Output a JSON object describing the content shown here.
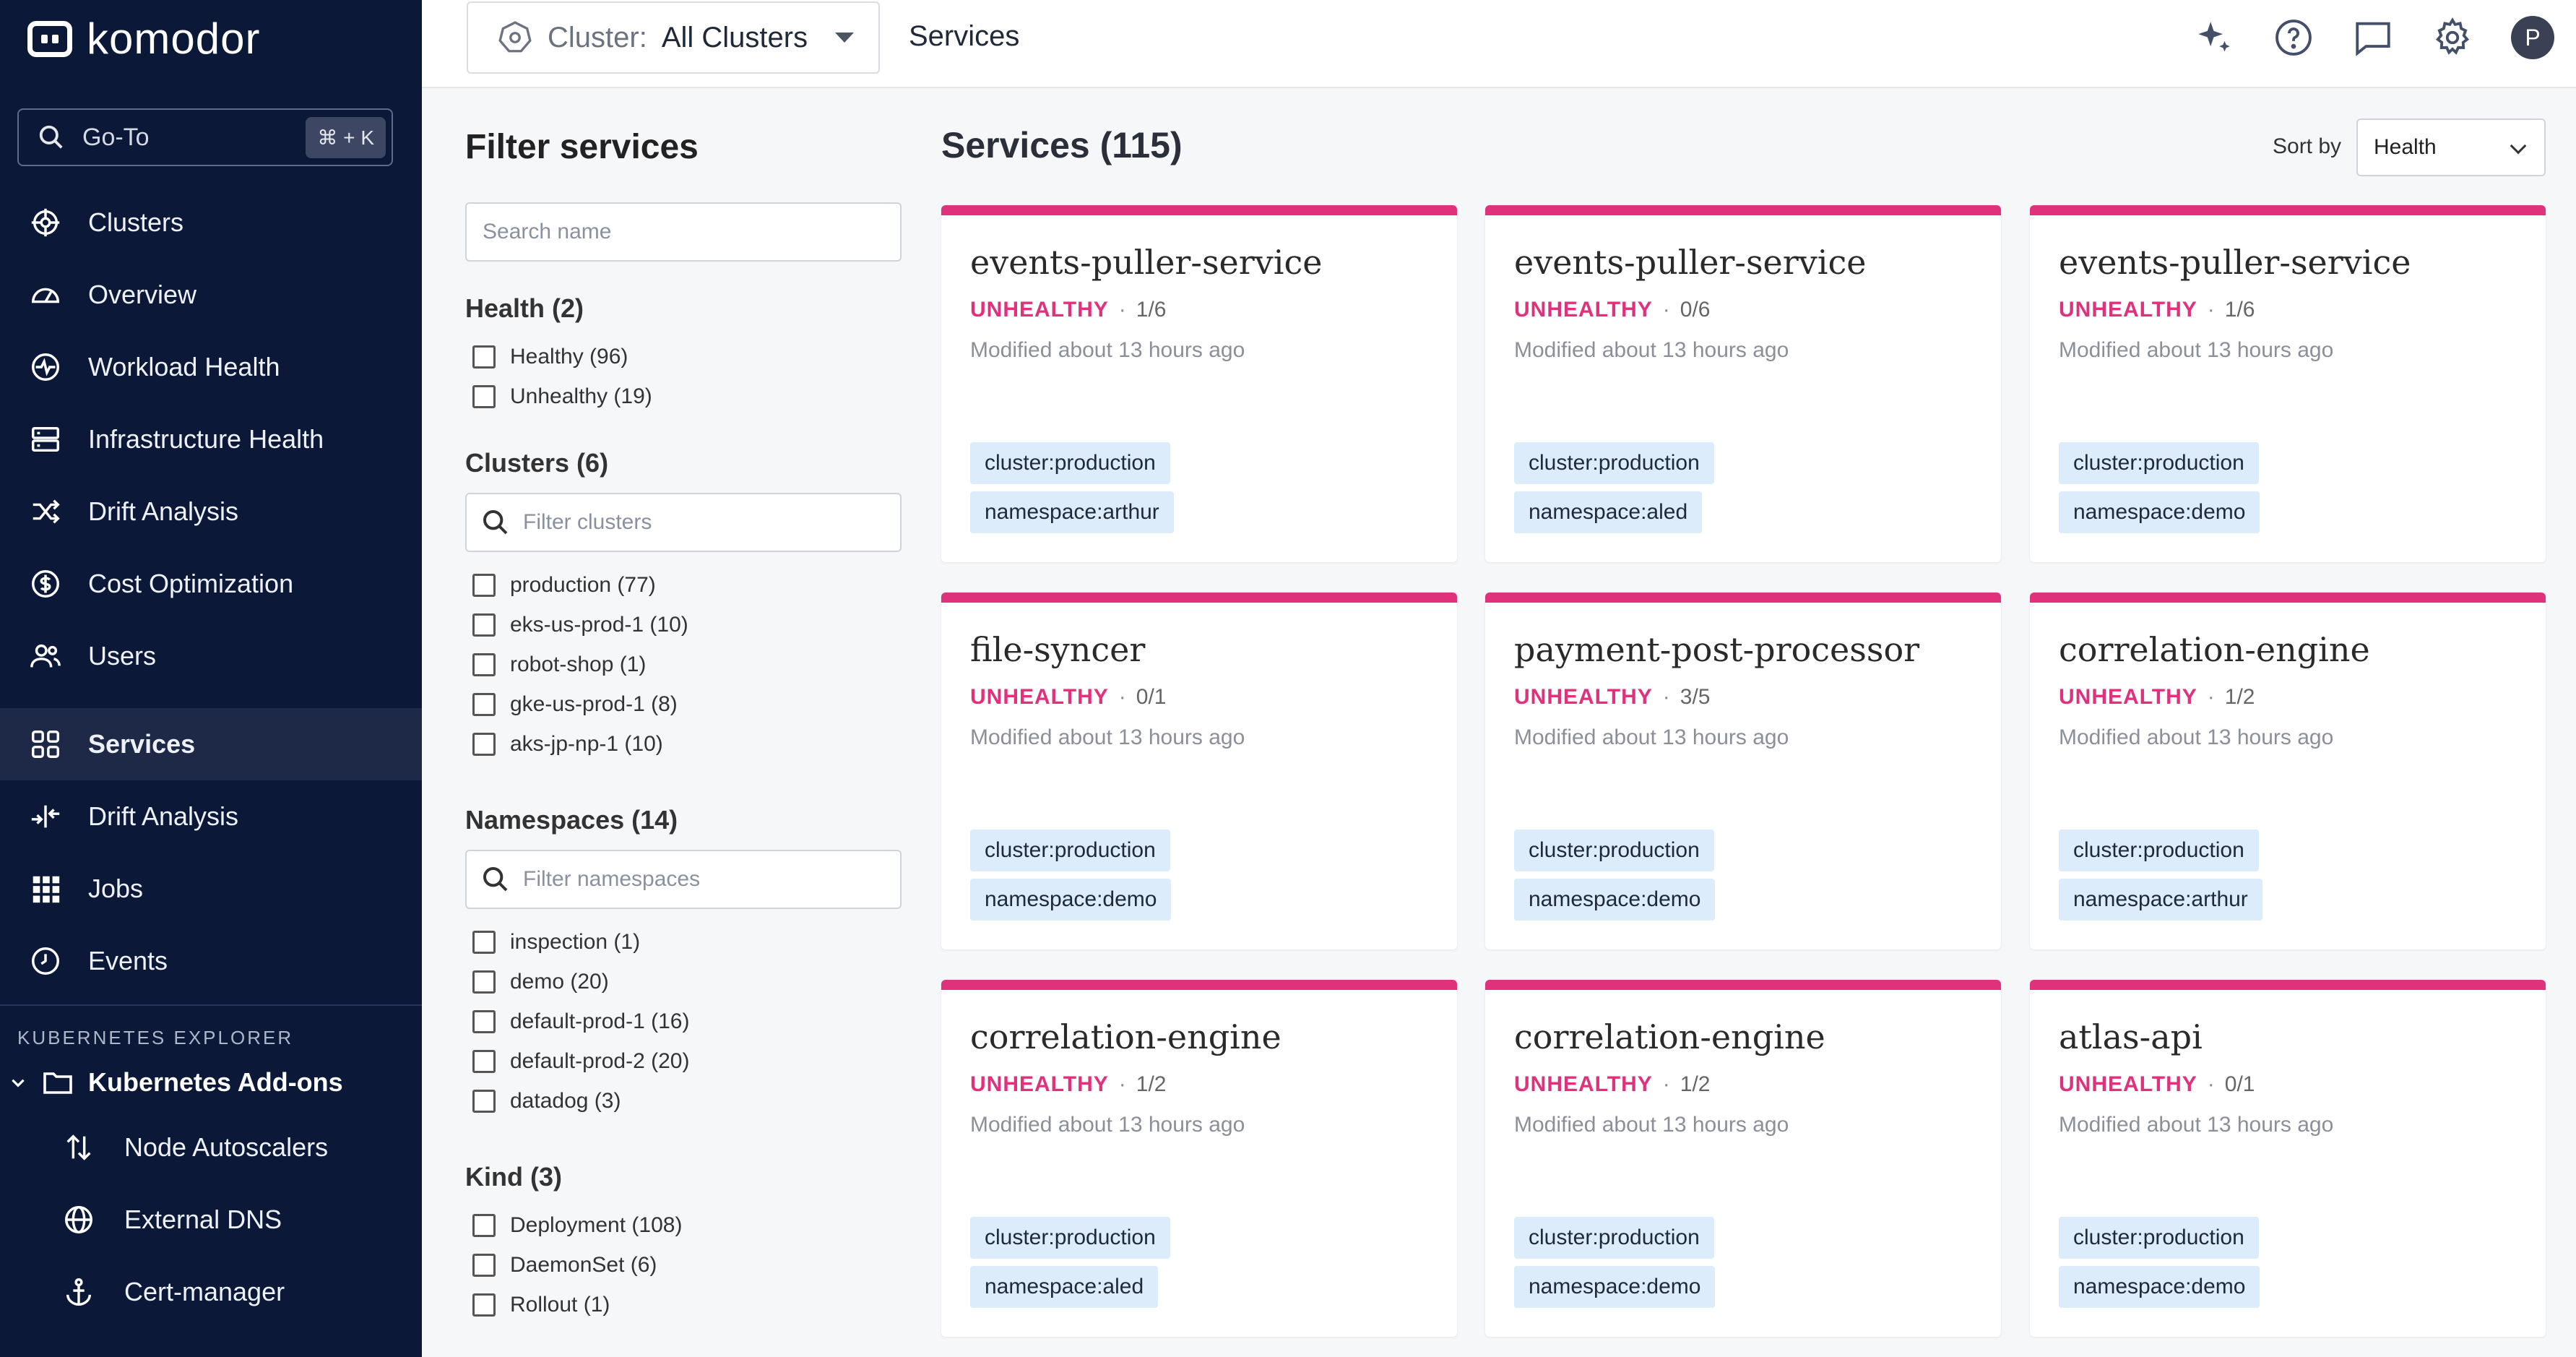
{
  "app": {
    "logo_text": "komodor",
    "goto_label": "Go-To",
    "goto_shortcut": "⌘ + K"
  },
  "sidebar": {
    "items": [
      {
        "label": "Clusters",
        "icon": "helm-wheel-icon"
      },
      {
        "label": "Overview",
        "icon": "gauge-icon"
      },
      {
        "label": "Workload Health",
        "icon": "heartbeat-icon"
      },
      {
        "label": "Infrastructure Health",
        "icon": "server-icon"
      },
      {
        "label": "Drift Analysis",
        "icon": "shuffle-icon"
      },
      {
        "label": "Cost Optimization",
        "icon": "dollar-circle-icon"
      },
      {
        "label": "Users",
        "icon": "users-icon"
      }
    ],
    "items2": [
      {
        "label": "Services",
        "icon": "grid-icon",
        "active": true
      },
      {
        "label": "Drift Analysis",
        "icon": "compare-icon"
      },
      {
        "label": "Jobs",
        "icon": "dots-grid-icon"
      },
      {
        "label": "Events",
        "icon": "clock-icon"
      }
    ],
    "section_label": "KUBERNETES EXPLORER",
    "addons_label": "Kubernetes Add-ons",
    "addons": [
      {
        "label": "Node Autoscalers",
        "icon": "up-down-arrows-icon"
      },
      {
        "label": "External DNS",
        "icon": "globe-icon"
      },
      {
        "label": "Cert-manager",
        "icon": "anchor-icon"
      }
    ]
  },
  "topbar": {
    "cluster_key": "Cluster:",
    "cluster_value": "All Clusters",
    "breadcrumb": "Services"
  },
  "filters": {
    "title": "Filter services",
    "search_placeholder": "Search name",
    "health": {
      "title": "Health (2)",
      "options": [
        "Healthy (96)",
        "Unhealthy (19)"
      ]
    },
    "clusters": {
      "title": "Clusters (6)",
      "placeholder": "Filter clusters",
      "options": [
        "production (77)",
        "eks-us-prod-1 (10)",
        "robot-shop (1)",
        "gke-us-prod-1 (8)",
        "aks-jp-np-1 (10)"
      ]
    },
    "namespaces": {
      "title": "Namespaces (14)",
      "placeholder": "Filter namespaces",
      "options": [
        "inspection (1)",
        "demo (20)",
        "default-prod-1 (16)",
        "default-prod-2 (20)",
        "datadog (3)"
      ]
    },
    "kind": {
      "title": "Kind (3)",
      "options": [
        "Deployment (108)",
        "DaemonSet (6)",
        "Rollout (1)"
      ]
    }
  },
  "main": {
    "title": "Services (115)",
    "sort_label": "Sort by",
    "sort_value": "Health",
    "colors": {
      "unhealthy": "#e0317d",
      "tag_bg": "#dcecfb"
    },
    "cards": [
      {
        "name": "events-puller-service",
        "status": "UNHEALTHY",
        "count": "1/6",
        "modified": "Modified about 13 hours ago",
        "cluster": "cluster:production",
        "namespace": "namespace:arthur"
      },
      {
        "name": "events-puller-service",
        "status": "UNHEALTHY",
        "count": "0/6",
        "modified": "Modified about 13 hours ago",
        "cluster": "cluster:production",
        "namespace": "namespace:aled"
      },
      {
        "name": "events-puller-service",
        "status": "UNHEALTHY",
        "count": "1/6",
        "modified": "Modified about 13 hours ago",
        "cluster": "cluster:production",
        "namespace": "namespace:demo"
      },
      {
        "name": "file-syncer",
        "status": "UNHEALTHY",
        "count": "0/1",
        "modified": "Modified about 13 hours ago",
        "cluster": "cluster:production",
        "namespace": "namespace:demo"
      },
      {
        "name": "payment-post-processor",
        "status": "UNHEALTHY",
        "count": "3/5",
        "modified": "Modified about 13 hours ago",
        "cluster": "cluster:production",
        "namespace": "namespace:demo"
      },
      {
        "name": "correlation-engine",
        "status": "UNHEALTHY",
        "count": "1/2",
        "modified": "Modified about 13 hours ago",
        "cluster": "cluster:production",
        "namespace": "namespace:arthur"
      },
      {
        "name": "correlation-engine",
        "status": "UNHEALTHY",
        "count": "1/2",
        "modified": "Modified about 13 hours ago",
        "cluster": "cluster:production",
        "namespace": "namespace:aled"
      },
      {
        "name": "correlation-engine",
        "status": "UNHEALTHY",
        "count": "1/2",
        "modified": "Modified about 13 hours ago",
        "cluster": "cluster:production",
        "namespace": "namespace:demo"
      },
      {
        "name": "atlas-api",
        "status": "UNHEALTHY",
        "count": "0/1",
        "modified": "Modified about 13 hours ago",
        "cluster": "cluster:production",
        "namespace": "namespace:demo"
      }
    ]
  }
}
